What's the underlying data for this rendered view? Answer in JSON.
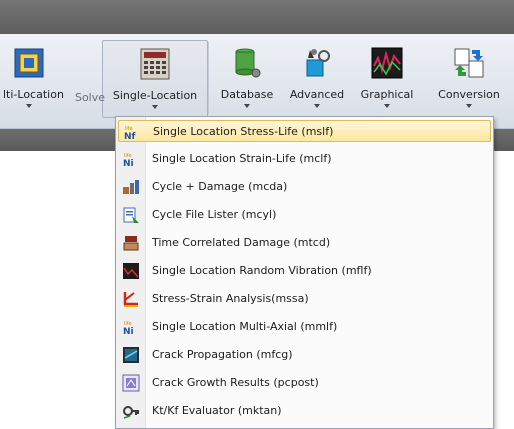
{
  "ribbon": {
    "group_label": "Solve",
    "buttons": [
      {
        "id": "multi-location",
        "label": "lti-Location",
        "icon": "multi-location-icon"
      },
      {
        "id": "single-location",
        "label": "Single-Location",
        "icon": "calculator-icon"
      },
      {
        "id": "database",
        "label": "Database",
        "icon": "database-icon"
      },
      {
        "id": "advanced",
        "label": "Advanced",
        "icon": "advanced-tools-icon"
      },
      {
        "id": "graphical",
        "label": "Graphical",
        "icon": "graph-display-icon"
      },
      {
        "id": "conversion",
        "label": "Conversion",
        "icon": "conversion-icon"
      }
    ]
  },
  "menu": {
    "items": [
      {
        "label": "Single Location Stress-Life (mslf)",
        "icon": "stress-life-nf-icon",
        "highlighted": true
      },
      {
        "label": "Single Location Strain-Life (mclf)",
        "icon": "strain-life-nf-icon"
      },
      {
        "label": "Cycle + Damage (mcda)",
        "icon": "cycle-damage-icon"
      },
      {
        "label": "Cycle File Lister (mcyl)",
        "icon": "file-lister-icon"
      },
      {
        "label": "Time Correlated Damage (mtcd)",
        "icon": "time-damage-icon"
      },
      {
        "label": "Single Location Random Vibration (mflf)",
        "icon": "random-vibration-icon"
      },
      {
        "label": "Stress-Strain Analysis(mssa)",
        "icon": "stress-strain-icon"
      },
      {
        "label": "Single Location Multi-Axial (mmlf)",
        "icon": "multi-axial-nf-icon"
      },
      {
        "label": "Crack Propagation (mfcg)",
        "icon": "crack-propagation-icon"
      },
      {
        "label": "Crack Growth Results (pcpost)",
        "icon": "crack-results-icon"
      },
      {
        "label": "Kt/Kf Evaluator (mktan)",
        "icon": "kt-kf-evaluator-icon"
      }
    ]
  },
  "colors": {
    "menu_highlight": "#ffe79a",
    "menu_highlight_border": "#e3b95a",
    "title_bar": "#6a6a6a"
  }
}
